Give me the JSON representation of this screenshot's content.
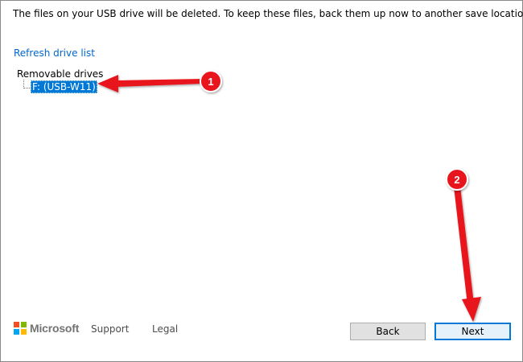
{
  "dialog": {
    "message": "The files on your USB drive will be deleted. To keep these files, back them up now to another save location.",
    "refresh_link": "Refresh drive list",
    "tree": {
      "root_label": "Removable drives",
      "items": [
        {
          "label": "F: (USB-W11)",
          "selected": true
        }
      ]
    }
  },
  "annotations": {
    "color": "#e8141c",
    "badges": [
      "1",
      "2"
    ]
  },
  "footer": {
    "brand": "Microsoft",
    "links": [
      "Support",
      "Legal"
    ],
    "buttons": {
      "back": "Back",
      "next": "Next"
    }
  },
  "colors": {
    "selection": "#0078d7",
    "link": "#0066cc",
    "default_button_border": "#0078d7"
  }
}
